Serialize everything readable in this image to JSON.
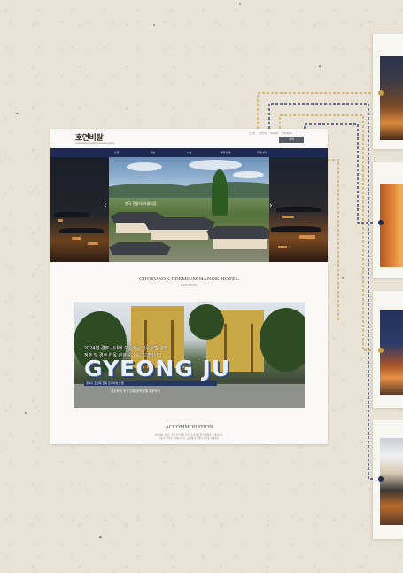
{
  "header": {
    "logo_text": "호연비탈",
    "logo_sub": "CHOSUNOK PREMIUM HANOK HOTEL",
    "util_links": [
      "로그인",
      "회원가입",
      "예약확인",
      "마이페이지"
    ],
    "book_label": "예약"
  },
  "nav": {
    "items": [
      "소개",
      "객실",
      "시설",
      "예약 안내",
      "커뮤니티"
    ]
  },
  "hero": {
    "caption": "한국 전통의 아름다움"
  },
  "hotel": {
    "title": "CHOSUNOK PREMIUM HANOK HOTEL",
    "subtitle": "GYEONGJU"
  },
  "promo": {
    "line1": "2024년 경주 시내에 오픈하는 한옥호텔 경주,",
    "line2": "정주 및 경주 한옥 관광 숙소로 초대합니다",
    "big_text": "GYEONG JU",
    "base_text": "경주시 조선옥 한옥 프리미엄 호텔",
    "badge": "경주문화 조선 전통 한옥호텔 방문하기"
  },
  "accommodation": {
    "title": "ACCOMMODATION",
    "desc1": "경주에서 만나는 가장 한국적인 휴식, 프리미엄 한옥 객실을 소개합니다.",
    "desc2": "전통과 현대가 조화를 이루는 공간에서 특별한 하루를 보내세요."
  },
  "colors": {
    "navy": "#1e2a54",
    "gold": "#c7a040",
    "paper": "#e9e3d7"
  }
}
